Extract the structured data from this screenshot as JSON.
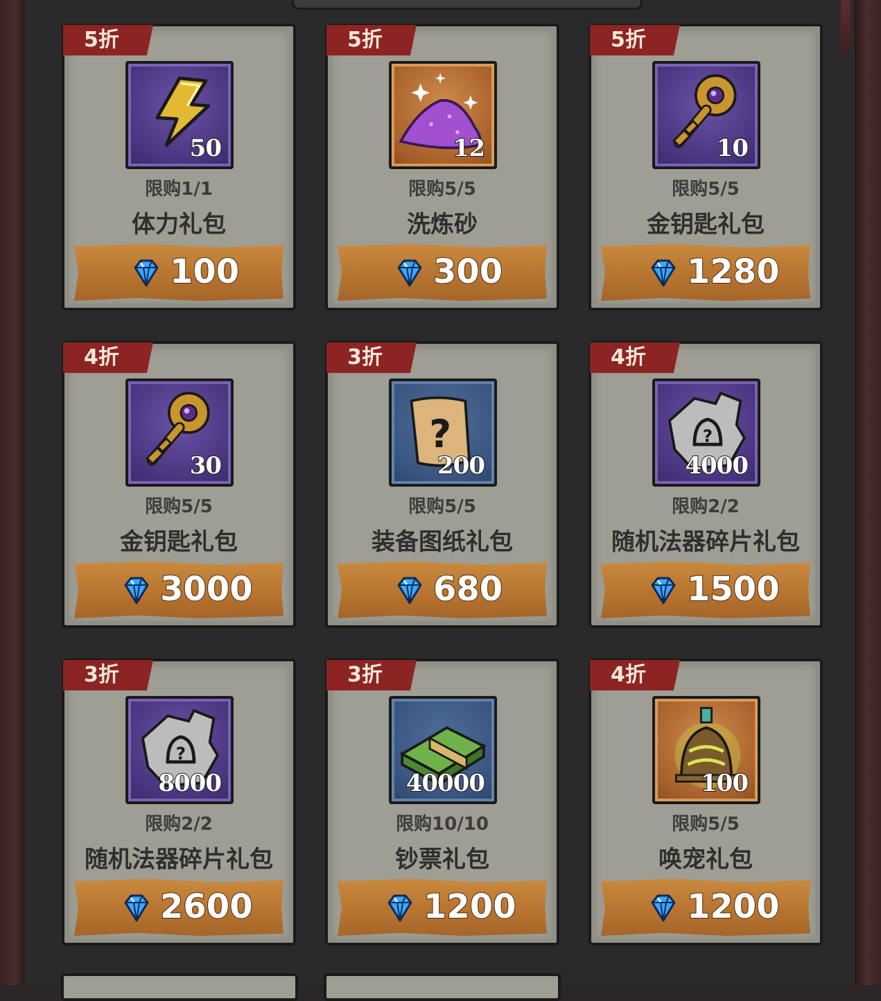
{
  "colors": {
    "card_bg": "#9e9e94",
    "badge_red": "#8c2424",
    "price_bar": "#b87430",
    "icon_purple": "#4a357f",
    "icon_orange": "#a9622c",
    "icon_blue": "#3a5580"
  },
  "currency_icon": "diamond-icon",
  "items": [
    {
      "discount": "5折",
      "qty": "50",
      "limit": "限购1/1",
      "name": "体力礼包",
      "price": "100",
      "icon": "lightning-icon",
      "bg": "purple"
    },
    {
      "discount": "5折",
      "qty": "12",
      "limit": "限购5/5",
      "name": "洗炼砂",
      "price": "300",
      "icon": "purple-sand-icon",
      "bg": "orange"
    },
    {
      "discount": "5折",
      "qty": "10",
      "limit": "限购5/5",
      "name": "金钥匙礼包",
      "price": "1280",
      "icon": "gold-key-icon",
      "bg": "purple"
    },
    {
      "discount": "4折",
      "qty": "30",
      "limit": "限购5/5",
      "name": "金钥匙礼包",
      "price": "3000",
      "icon": "gold-key-icon",
      "bg": "purple"
    },
    {
      "discount": "3折",
      "qty": "200",
      "limit": "限购5/5",
      "name": "装备图纸礼包",
      "price": "680",
      "icon": "mystery-scroll-icon",
      "bg": "blue"
    },
    {
      "discount": "4折",
      "qty": "4000",
      "limit": "限购2/2",
      "name": "随机法器碎片礼包",
      "price": "1500",
      "icon": "bell-fragment-icon",
      "bg": "purple"
    },
    {
      "discount": "3折",
      "qty": "8000",
      "limit": "限购2/2",
      "name": "随机法器碎片礼包",
      "price": "2600",
      "icon": "bell-fragment-icon",
      "bg": "purple"
    },
    {
      "discount": "3折",
      "qty": "40000",
      "limit": "限购10/10",
      "name": "钞票礼包",
      "price": "1200",
      "icon": "cash-stack-icon",
      "bg": "blue"
    },
    {
      "discount": "4折",
      "qty": "100",
      "limit": "限购5/5",
      "name": "唤宠礼包",
      "price": "1200",
      "icon": "summon-bell-icon",
      "bg": "orange"
    }
  ]
}
